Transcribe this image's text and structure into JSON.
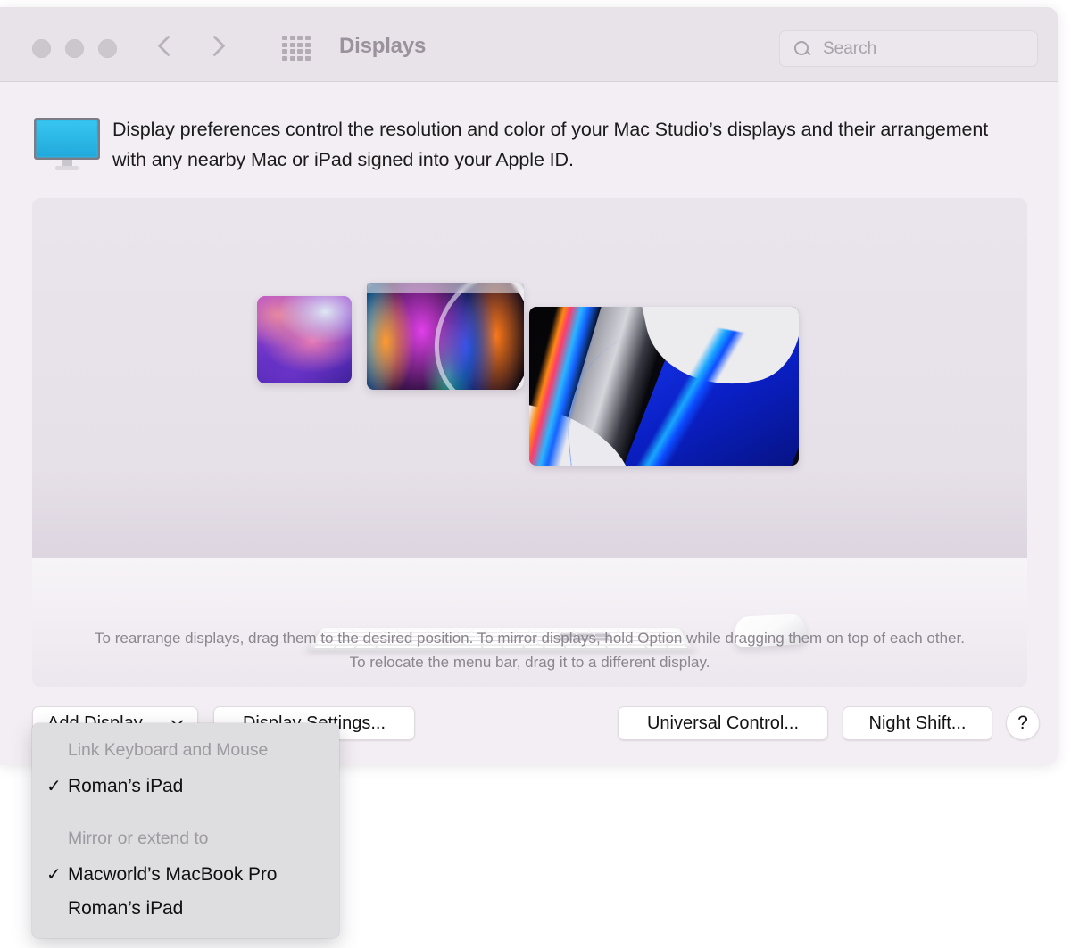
{
  "window": {
    "toolbar": {
      "title": "Displays",
      "back_icon": "chevron-left-icon",
      "forward_icon": "chevron-right-icon",
      "grid_icon": "grid-apps-icon",
      "traffic_lights": [
        "close",
        "minimize",
        "zoom"
      ]
    },
    "search": {
      "placeholder": "Search",
      "value": "",
      "icon": "search-icon"
    }
  },
  "description": {
    "icon": "display-monitor-icon",
    "text": "Display preferences control the resolution and color of your Mac Studio’s displays and their arrangement with any nearby Mac or iPad signed into your Apple ID."
  },
  "arrangement": {
    "hint": "To rearrange displays, drag them to the desired position. To mirror displays, hold Option while dragging them on top of each other. To relocate the menu bar, drag it to a different display.",
    "displays": [
      {
        "name": "display-thumbnail-1",
        "wallpaper": "purple-aurora",
        "has_menu_bar": false
      },
      {
        "name": "display-thumbnail-2",
        "wallpaper": "rainbow-swirl",
        "has_menu_bar": true
      },
      {
        "name": "display-thumbnail-3",
        "wallpaper": "blue-black-xdr",
        "has_menu_bar": false
      }
    ],
    "peripherals": [
      "magic-keyboard",
      "magic-mouse"
    ]
  },
  "buttons": {
    "add_display": "Add Display",
    "add_display_caret_icon": "chevron-down-icon",
    "display_settings": "Display Settings...",
    "universal_control": "Universal Control...",
    "night_shift": "Night Shift...",
    "help": "?"
  },
  "add_display_menu": {
    "sections": [
      {
        "header": "Link Keyboard and Mouse",
        "items": [
          {
            "label": "Roman’s iPad",
            "checked": true,
            "check_glyph": "✓"
          }
        ]
      },
      {
        "header": "Mirror or extend to",
        "items": [
          {
            "label": "Macworld’s MacBook Pro",
            "checked": true,
            "check_glyph": "✓"
          },
          {
            "label": "Roman’s iPad",
            "checked": false,
            "check_glyph": ""
          }
        ]
      }
    ]
  },
  "colors": {
    "window_bg": "#f3eef3",
    "toolbar_bg": "#e8e2e9",
    "panel_bg": "#e6e0e8",
    "menu_bg": "#dedde0",
    "accent_monitor": "#2ab8e8",
    "text_primary": "#1b1b1d",
    "text_muted": "#8b858e"
  }
}
